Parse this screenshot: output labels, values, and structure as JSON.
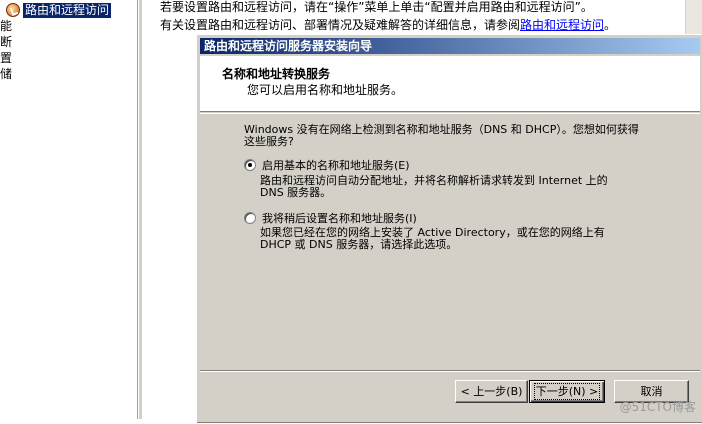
{
  "tree": {
    "selected_node": "路由和远程访问",
    "fragments": [
      "能",
      "断",
      "置",
      "储"
    ]
  },
  "content": {
    "line1": "若要设置路由和远程访问，请在“操作”菜单上单击“配置并启用路由和远程访问”。",
    "line2_prefix": "有关设置路由和远程访问、部署情况及疑难解答的详细信息，请参阅",
    "line2_link": "路由和远程访问",
    "line2_suffix": "。"
  },
  "wizard": {
    "title": "路由和远程访问服务器安装向导",
    "header_title": "名称和地址转换服务",
    "header_subtitle": "您可以启用名称和地址服务。",
    "question_line1": "Windows 没有在网络上检测到名称和地址服务（DNS 和 DHCP）。您想如何获得",
    "question_line2": "这些服务?",
    "option1": {
      "label": "启用基本的名称和地址服务(E)",
      "checked": true,
      "desc_line1": "路由和远程访问自动分配地址，并将名称解析请求转发到 Internet 上的",
      "desc_line2": "DNS 服务器。"
    },
    "option2": {
      "label": "我将稍后设置名称和地址服务(I)",
      "checked": false,
      "desc_line1": "如果您已经在您的网络上安装了 Active Directory，或在您的网络上有",
      "desc_line2": "DHCP 或 DNS 服务器，请选择此选项。"
    },
    "buttons": {
      "back": "< 上一步(B)",
      "next": "下一步(N) >",
      "cancel": "取消"
    }
  },
  "watermark": "@51CTO博客"
}
